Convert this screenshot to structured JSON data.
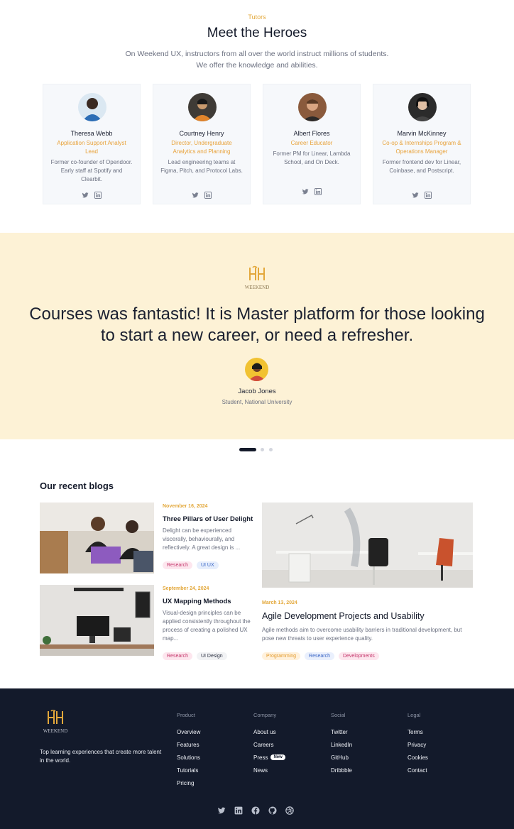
{
  "tutors": {
    "eyebrow": "Tutors",
    "title": "Meet the Heroes",
    "subtitle_line1": "On Weekend UX, instructors from all over the world instruct millions of students.",
    "subtitle_line2": "We offer the knowledge and abilities.",
    "cards": [
      {
        "name": "Theresa Webb",
        "role": "Application Support Analyst Lead",
        "desc": "Former co-founder of Opendoor. Early staff at Spotify and Clearbit."
      },
      {
        "name": "Courtney Henry",
        "role": "Director, Undergraduate Analytics and Planning",
        "desc": "Lead engineering teams at Figma, Pitch, and Protocol Labs."
      },
      {
        "name": "Albert Flores",
        "role": "Career Educator",
        "desc": "Former PM for Linear, Lambda School, and On Deck."
      },
      {
        "name": "Marvin McKinney",
        "role": "Co-op & Internships Program & Operations Manager",
        "desc": "Former frontend dev for Linear, Coinbase, and Postscript."
      }
    ]
  },
  "testimonial": {
    "logo_text": "WEEKEND",
    "quote": "Courses was fantastic! It is Master platform for those looking to start a new career, or need a refresher.",
    "name": "Jacob Jones",
    "role": "Student, National University"
  },
  "blogs": {
    "title": "Our recent blogs",
    "posts": [
      {
        "date": "November 16, 2024",
        "title": "Three Pillars of User Delight",
        "excerpt": "Delight can be experienced viscerally, behaviourally, and reflectively. A great design is ...",
        "tags": [
          "Research",
          "UI UX"
        ]
      },
      {
        "date": "September 24, 2024",
        "title": "UX Mapping Methods",
        "excerpt": "Visual-design principles can be applied consistently throughout the process of creating a polished UX map...",
        "tags": [
          "Research",
          "UI Design"
        ]
      },
      {
        "date": "March 13, 2024",
        "title": "Agile Development Projects and Usability",
        "excerpt": "Agile methods aim to overcome usability barriers in traditional development, but pose new threats to user experience quality.",
        "tags": [
          "Programming",
          "Research",
          "Developments"
        ]
      }
    ]
  },
  "footer": {
    "logo_text": "WEEKEND",
    "tagline": "Top learning experiences that create more talent in the world.",
    "columns": [
      {
        "heading": "Product",
        "links": [
          "Overview",
          "Features",
          "Solutions",
          "Tutorials",
          "Pricing"
        ]
      },
      {
        "heading": "Company",
        "links": [
          "About us",
          "Careers",
          "Press",
          "News"
        ]
      },
      {
        "heading": "Social",
        "links": [
          "Twitter",
          "LinkedIn",
          "GitHub",
          "Dribbble"
        ]
      },
      {
        "heading": "Legal",
        "links": [
          "Terms",
          "Privacy",
          "Cookies",
          "Contact"
        ]
      }
    ],
    "press_badge": "New"
  },
  "colors": {
    "accent": "#e3a83b",
    "testimonial_bg": "#fdf2d6",
    "footer_bg": "#131a2b"
  }
}
